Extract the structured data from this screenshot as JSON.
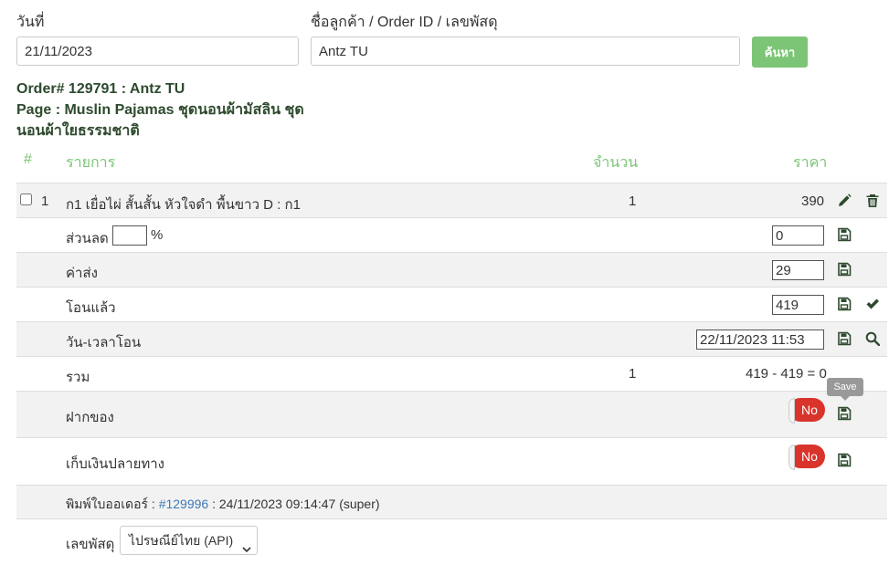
{
  "search": {
    "date_label": "วันที่",
    "date_value": "21/11/2023",
    "customer_label": "ชื่อลูกค้า / Order ID / เลขพัสดุ",
    "customer_value": "Antz TU",
    "search_button": "ค้นหา"
  },
  "order": {
    "title_line1": "Order# 129791 : Antz TU",
    "title_line2": "Page : Muslin Pajamas ชุดนอนผ้ามัสลิน ชุด",
    "title_line3": "นอนผ้าใยธรรมชาติ"
  },
  "table": {
    "headers": {
      "num": "#",
      "item": "รายการ",
      "qty": "จำนวน",
      "price": "ราคา"
    },
    "item": {
      "num": "1",
      "name": "ก1 เยื่อไผ่ สั้นสั้น หัวใจดำ พื้นขาว D : ก1",
      "qty": "1",
      "price": "390"
    },
    "discount": {
      "label": "ส่วนลด",
      "percent_value": "",
      "percent_sign": "%",
      "value": "0"
    },
    "shipping": {
      "label": "ค่าส่ง",
      "value": "29"
    },
    "paid": {
      "label": "โอนแล้ว",
      "value": "419"
    },
    "paid_time": {
      "label": "วัน-เวลาโอน",
      "value": "22/11/2023 11:53"
    },
    "total": {
      "label": "รวม",
      "qty": "1",
      "value": "419 - 419 = 0"
    },
    "deposit": {
      "label": "ฝากของ",
      "toggle": "No"
    },
    "cod": {
      "label": "เก็บเงินปลายทาง",
      "toggle": "No"
    },
    "print": {
      "label": "พิมพ์ใบออเดอร์ :",
      "link": "#129996",
      "info": ": 24/11/2023 09:14:47 (super)"
    },
    "tracking": {
      "label": "เลขพัสดุ",
      "selected": "ไปรษณีย์ไทย (API)"
    }
  },
  "tooltip": {
    "text": "Save"
  },
  "colors": {
    "accent": "#7cc576",
    "toggle_off": "#d9342b",
    "icon": "#2e4a2e",
    "link": "#3d7ab8"
  },
  "icons": [
    "pencil-icon",
    "trash-icon",
    "save-icon",
    "check-icon",
    "search-icon",
    "chevron-down-icon"
  ]
}
